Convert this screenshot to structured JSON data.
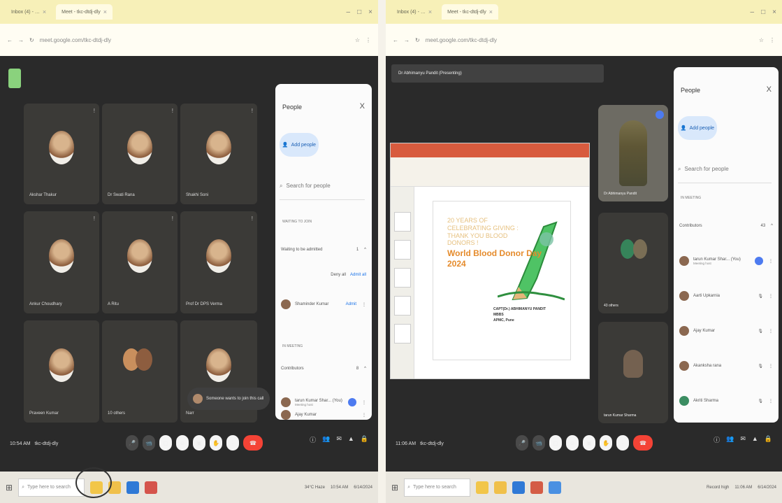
{
  "left": {
    "browser": {
      "tabs": [
        "Inbox (4) - …",
        "Meet - tkc-dtdj-dly"
      ],
      "url": "meet.google.com/tkc-dtdj-dly"
    },
    "participants": [
      "Akshar Thakur",
      "Dr Swati Rana",
      "Shakhi Soni",
      "Ankur Choudhary",
      "A Ritu",
      "Prof Dr DPS Verma",
      "Praveen Kumar",
      "10 others",
      "Narr"
    ],
    "notification": "Someone wants to join this call",
    "people_panel": {
      "title": "People",
      "close": "X",
      "add_people": "Add people",
      "search_placeholder": "Search for people",
      "waiting_label": "WAITING TO JOIN",
      "waiting_row": "Waiting to be admitted",
      "waiting_count": "1",
      "deny_all": "Deny all",
      "admit_all": "Admit all",
      "waiting_person": "Shaminder Kumar",
      "admit": "Admit",
      "in_meeting_label": "IN MEETING",
      "contributors": "Contributors",
      "contributors_count": "8",
      "contributors_list": [
        "tarun Kumar Shar... (You)",
        "Ajay Kumar"
      ],
      "contributors_sub": "Meeting host"
    },
    "meeting_info": {
      "time": "10:54 AM",
      "code": "tkc-dtdj-dly"
    },
    "taskbar": {
      "search": "Type here to search",
      "weather": "34°C Haze",
      "clock": "10:54 AM",
      "date": "6/14/2024"
    }
  },
  "right": {
    "browser": {
      "tabs": [
        "Inbox (4) - …",
        "Meet - tkc-dtdj-dly"
      ],
      "url": "meet.google.com/tkc-dtdj-dly"
    },
    "presenter": "Dr Abhimanyu Pandit (Presenting)",
    "slide": {
      "line1": "20 YEARS OF CELEBRATING GIVING : THANK YOU BLOOD DONORS !",
      "line2": "World Blood Donor Day 2024",
      "line3": "CAPT(Dr.) ABHIMANYU PANDIT",
      "line4": "MBBS",
      "line5": "APMC, Pune"
    },
    "video_name": "Dr Abhimanyu Pandit",
    "group_tile": "43 others",
    "person_tile": "tarun Kumar Sharma",
    "people_panel": {
      "title": "People",
      "close": "X",
      "add_people": "Add people",
      "search_placeholder": "Search for people",
      "in_meeting_label": "IN MEETING",
      "contributors": "Contributors",
      "contributors_count": "43",
      "list": [
        {
          "name": "tarun Kumar Shar... (You)",
          "sub": "Meeting host"
        },
        {
          "name": "Aarti Upkarnia"
        },
        {
          "name": "Ajay Kumar"
        },
        {
          "name": "Akanksha rana"
        },
        {
          "name": "Akriti Sharma"
        }
      ]
    },
    "meeting_info": {
      "time": "11:06 AM",
      "code": "tkc-dtdj-dly"
    },
    "taskbar": {
      "search": "Type here to search",
      "weather": "Record high",
      "clock": "11:06 AM",
      "date": "6/14/2024"
    }
  }
}
